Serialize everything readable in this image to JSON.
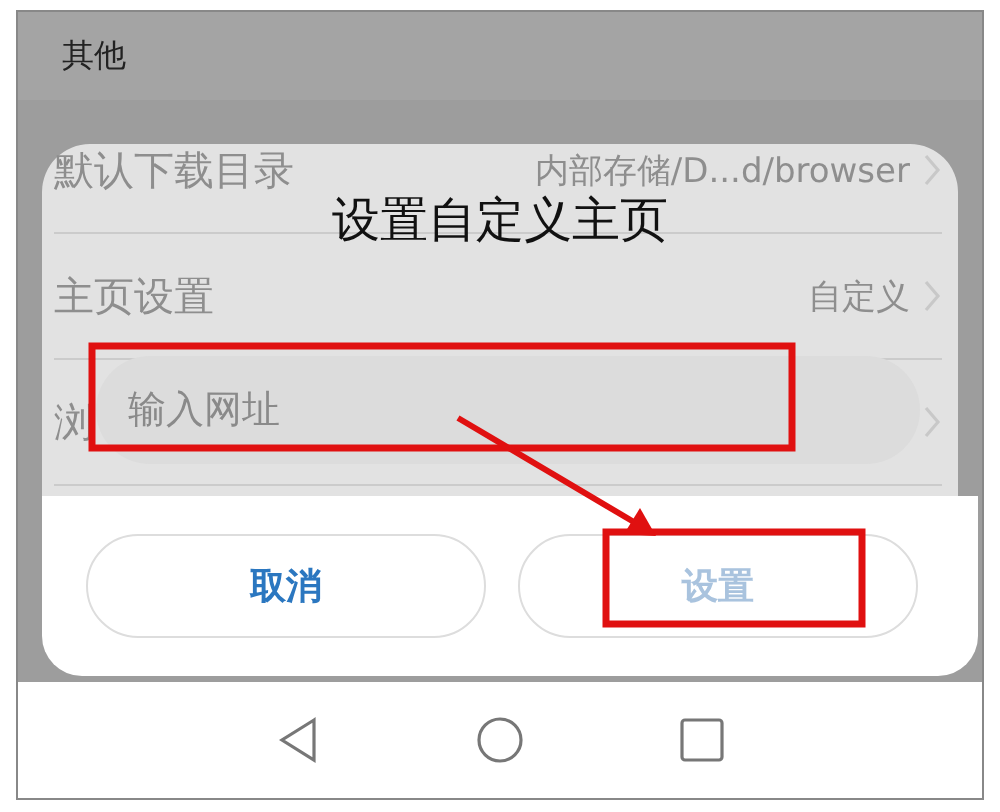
{
  "header": {
    "title": "其他"
  },
  "settings": [
    {
      "label": "默认下载目录",
      "value": "内部存储/D...d/browser"
    },
    {
      "label": "主页设置",
      "value": "自定义"
    },
    {
      "label": "浏"
    }
  ],
  "dialog": {
    "title": "设置自定义主页",
    "input": {
      "placeholder": "输入网址"
    },
    "buttons": [
      {
        "label": "取消",
        "disabled": false
      },
      {
        "label": "设置",
        "disabled": true
      }
    ]
  }
}
